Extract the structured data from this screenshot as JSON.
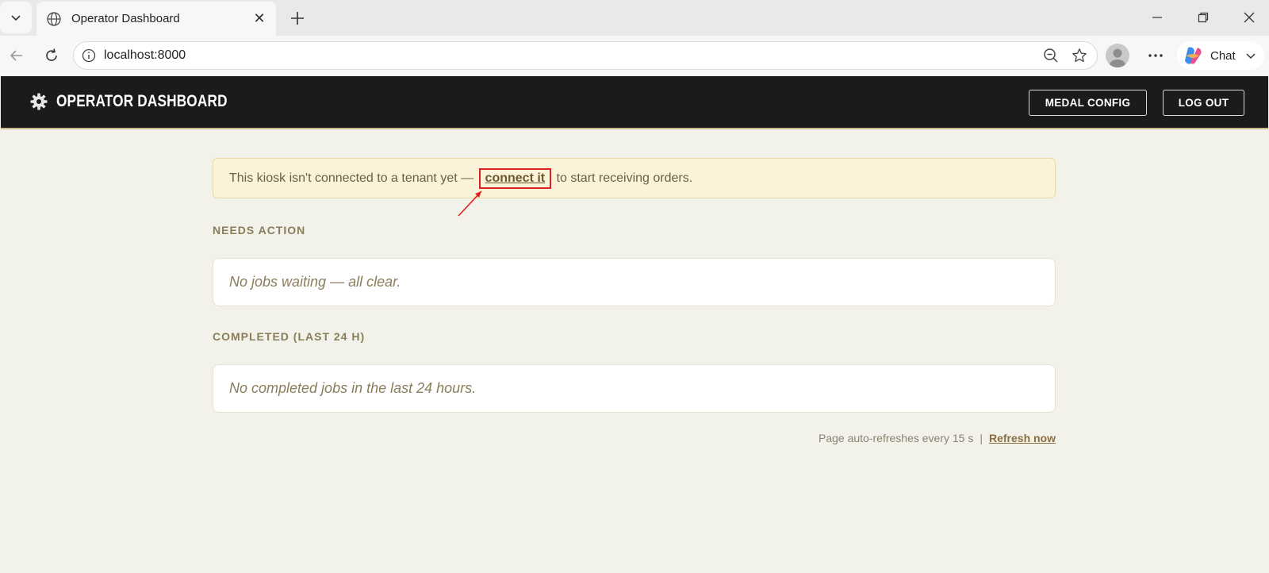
{
  "browser": {
    "tab_title": "Operator Dashboard",
    "url": "localhost:8000",
    "chat_label": "Chat"
  },
  "header": {
    "title": "OPERATOR DASHBOARD",
    "medal_config_label": "MEDAL CONFIG",
    "logout_label": "LOG OUT"
  },
  "alert": {
    "text_before": "This kiosk isn't connected to a tenant yet — ",
    "link_text": "connect it",
    "text_after": " to start receiving orders."
  },
  "needs_action": {
    "title": "NEEDS ACTION",
    "empty_message": "No jobs waiting — all clear."
  },
  "completed": {
    "title": "COMPLETED (LAST 24 H)",
    "empty_message": "No completed jobs in the last 24 hours."
  },
  "footer": {
    "auto_refresh_text": "Page auto-refreshes every 15 s",
    "separator": "|",
    "refresh_link": "Refresh now"
  },
  "colors": {
    "header_bg": "#1b1b1b",
    "page_bg": "#f3f2ea",
    "alert_bg": "#fbf3d9",
    "accent": "#8a7d5a",
    "annotation": "#e02020"
  }
}
